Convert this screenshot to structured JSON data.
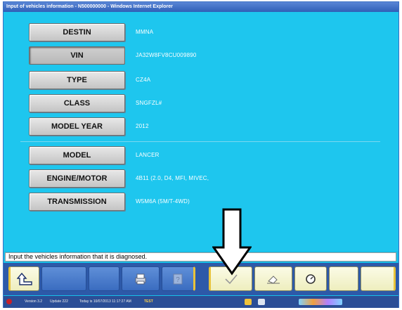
{
  "window": {
    "title": "Input of vehicles information - N500000000 - Windows Internet Explorer"
  },
  "fields_top": [
    {
      "label": "DESTIN",
      "value": "MMNA"
    },
    {
      "label": "VIN",
      "value": "JA32W8FV8CU009890"
    },
    {
      "label": "TYPE",
      "value": "CZ4A"
    },
    {
      "label": "CLASS",
      "value": "SNGFZL#"
    },
    {
      "label": "MODEL YEAR",
      "value": "2012"
    }
  ],
  "fields_bottom": [
    {
      "label": "MODEL",
      "value": "LANCER"
    },
    {
      "label": "ENGINE/MOTOR",
      "value": "4B11 (2.0, D4, MFI, MIVEC,"
    },
    {
      "label": "TRANSMISSION",
      "value": "W5M6A (5M/T-4WD)"
    }
  ],
  "message": "Input the vehicles information that it is diagnosed.",
  "toolbar": {
    "buttons": [
      "back-icon",
      "blank",
      "blank",
      "print-icon",
      "help-icon",
      "check-icon",
      "eraser-icon",
      "clock-icon",
      "blank",
      "blank"
    ]
  },
  "statusbar": {
    "version": "Version 3.2",
    "update": "Update 222",
    "today": "Today is 10/07/2013 11:17:27 AM",
    "mode": "TEST"
  },
  "colors": {
    "background": "#1ec6ee",
    "toolbar": "#2d59a8",
    "button_cream": "#fbfbe6",
    "gold_edge": "#e9c33a"
  }
}
